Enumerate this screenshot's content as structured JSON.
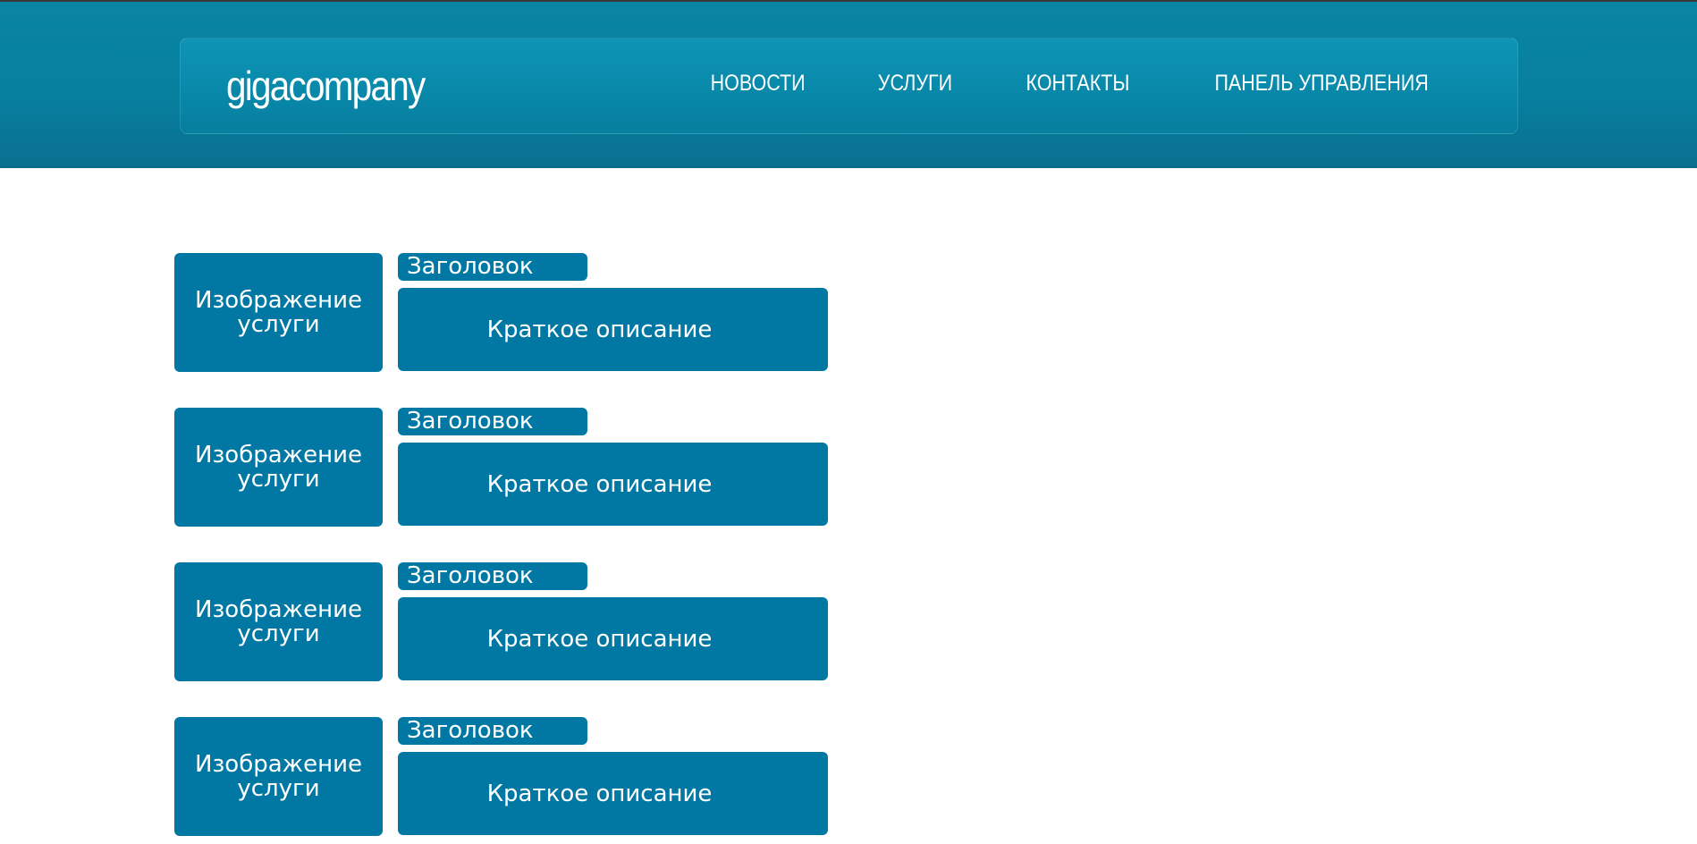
{
  "header": {
    "logo": "gigacompany",
    "nav": [
      {
        "label": "НОВОСТИ"
      },
      {
        "label": "УСЛУГИ"
      },
      {
        "label": "КОНТАКТЫ"
      },
      {
        "label": "ПАНЕЛЬ УПРАВЛЕНИЯ"
      }
    ]
  },
  "services": [
    {
      "image_label": "Изображение услуги",
      "title": "Заголовок",
      "description": "Краткое описание"
    },
    {
      "image_label": "Изображение услуги",
      "title": "Заголовок",
      "description": "Краткое описание"
    },
    {
      "image_label": "Изображение услуги",
      "title": "Заголовок",
      "description": "Краткое описание"
    },
    {
      "image_label": "Изображение услуги",
      "title": "Заголовок",
      "description": "Краткое описание"
    }
  ],
  "colors": {
    "header_bg": "#0a84a3",
    "block_bg": "#0078a3",
    "text": "#ffffff"
  }
}
